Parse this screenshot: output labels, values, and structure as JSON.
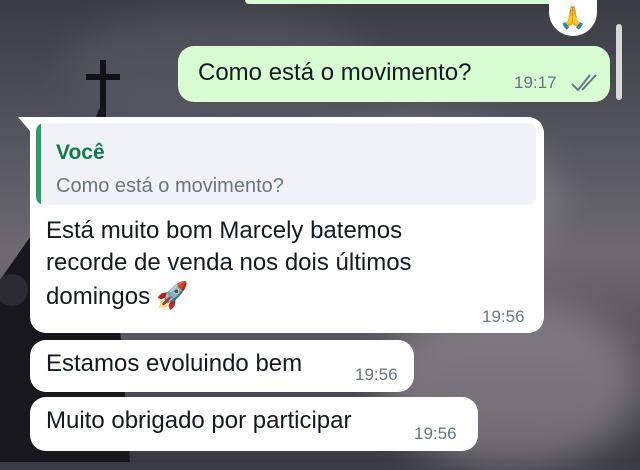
{
  "reaction": {
    "emoji": "🙏",
    "icon": "praying-hands-icon"
  },
  "messages": [
    {
      "direction": "outgoing",
      "text": "Como está o movimento?",
      "time": "19:17",
      "status_icon": "double-check-icon"
    },
    {
      "direction": "incoming",
      "quote": {
        "author": "Você",
        "text": "Como está o movimento?"
      },
      "text": "Está muito bom Marcely batemos recorde de venda nos dois últimos domingos",
      "emoji": "🚀",
      "time": "19:56"
    },
    {
      "direction": "incoming",
      "text": "Estamos evoluindo bem",
      "time": "19:56"
    },
    {
      "direction": "incoming",
      "text": "Muito obrigado por participar",
      "time": "19:56"
    }
  ],
  "colors": {
    "outgoing_bubble": "#d9fdd3",
    "incoming_bubble": "#ffffff",
    "quote_accent": "#25a06b",
    "quote_author": "#0f7a4d",
    "meta_text": "#667781"
  }
}
